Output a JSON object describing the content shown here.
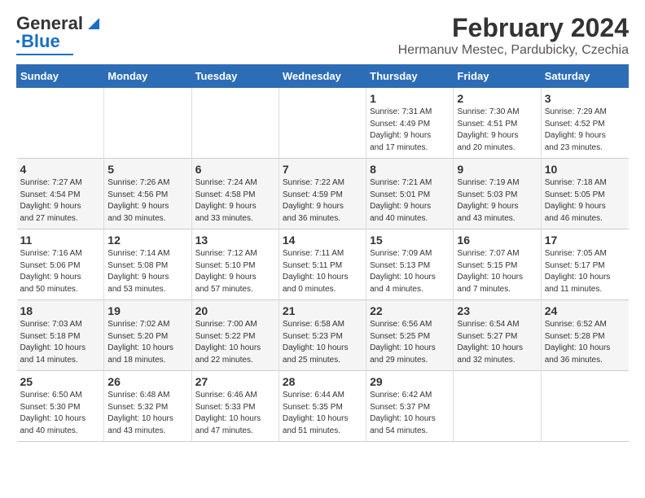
{
  "app": {
    "logo_line1": "General",
    "logo_line2": "Blue"
  },
  "title": "February 2024",
  "subtitle": "Hermanuv Mestec, Pardubicky, Czechia",
  "days_of_week": [
    "Sunday",
    "Monday",
    "Tuesday",
    "Wednesday",
    "Thursday",
    "Friday",
    "Saturday"
  ],
  "weeks": [
    [
      {
        "day": "",
        "info": ""
      },
      {
        "day": "",
        "info": ""
      },
      {
        "day": "",
        "info": ""
      },
      {
        "day": "",
        "info": ""
      },
      {
        "day": "1",
        "info": "Sunrise: 7:31 AM\nSunset: 4:49 PM\nDaylight: 9 hours\nand 17 minutes."
      },
      {
        "day": "2",
        "info": "Sunrise: 7:30 AM\nSunset: 4:51 PM\nDaylight: 9 hours\nand 20 minutes."
      },
      {
        "day": "3",
        "info": "Sunrise: 7:29 AM\nSunset: 4:52 PM\nDaylight: 9 hours\nand 23 minutes."
      }
    ],
    [
      {
        "day": "4",
        "info": "Sunrise: 7:27 AM\nSunset: 4:54 PM\nDaylight: 9 hours\nand 27 minutes."
      },
      {
        "day": "5",
        "info": "Sunrise: 7:26 AM\nSunset: 4:56 PM\nDaylight: 9 hours\nand 30 minutes."
      },
      {
        "day": "6",
        "info": "Sunrise: 7:24 AM\nSunset: 4:58 PM\nDaylight: 9 hours\nand 33 minutes."
      },
      {
        "day": "7",
        "info": "Sunrise: 7:22 AM\nSunset: 4:59 PM\nDaylight: 9 hours\nand 36 minutes."
      },
      {
        "day": "8",
        "info": "Sunrise: 7:21 AM\nSunset: 5:01 PM\nDaylight: 9 hours\nand 40 minutes."
      },
      {
        "day": "9",
        "info": "Sunrise: 7:19 AM\nSunset: 5:03 PM\nDaylight: 9 hours\nand 43 minutes."
      },
      {
        "day": "10",
        "info": "Sunrise: 7:18 AM\nSunset: 5:05 PM\nDaylight: 9 hours\nand 46 minutes."
      }
    ],
    [
      {
        "day": "11",
        "info": "Sunrise: 7:16 AM\nSunset: 5:06 PM\nDaylight: 9 hours\nand 50 minutes."
      },
      {
        "day": "12",
        "info": "Sunrise: 7:14 AM\nSunset: 5:08 PM\nDaylight: 9 hours\nand 53 minutes."
      },
      {
        "day": "13",
        "info": "Sunrise: 7:12 AM\nSunset: 5:10 PM\nDaylight: 9 hours\nand 57 minutes."
      },
      {
        "day": "14",
        "info": "Sunrise: 7:11 AM\nSunset: 5:11 PM\nDaylight: 10 hours\nand 0 minutes."
      },
      {
        "day": "15",
        "info": "Sunrise: 7:09 AM\nSunset: 5:13 PM\nDaylight: 10 hours\nand 4 minutes."
      },
      {
        "day": "16",
        "info": "Sunrise: 7:07 AM\nSunset: 5:15 PM\nDaylight: 10 hours\nand 7 minutes."
      },
      {
        "day": "17",
        "info": "Sunrise: 7:05 AM\nSunset: 5:17 PM\nDaylight: 10 hours\nand 11 minutes."
      }
    ],
    [
      {
        "day": "18",
        "info": "Sunrise: 7:03 AM\nSunset: 5:18 PM\nDaylight: 10 hours\nand 14 minutes."
      },
      {
        "day": "19",
        "info": "Sunrise: 7:02 AM\nSunset: 5:20 PM\nDaylight: 10 hours\nand 18 minutes."
      },
      {
        "day": "20",
        "info": "Sunrise: 7:00 AM\nSunset: 5:22 PM\nDaylight: 10 hours\nand 22 minutes."
      },
      {
        "day": "21",
        "info": "Sunrise: 6:58 AM\nSunset: 5:23 PM\nDaylight: 10 hours\nand 25 minutes."
      },
      {
        "day": "22",
        "info": "Sunrise: 6:56 AM\nSunset: 5:25 PM\nDaylight: 10 hours\nand 29 minutes."
      },
      {
        "day": "23",
        "info": "Sunrise: 6:54 AM\nSunset: 5:27 PM\nDaylight: 10 hours\nand 32 minutes."
      },
      {
        "day": "24",
        "info": "Sunrise: 6:52 AM\nSunset: 5:28 PM\nDaylight: 10 hours\nand 36 minutes."
      }
    ],
    [
      {
        "day": "25",
        "info": "Sunrise: 6:50 AM\nSunset: 5:30 PM\nDaylight: 10 hours\nand 40 minutes."
      },
      {
        "day": "26",
        "info": "Sunrise: 6:48 AM\nSunset: 5:32 PM\nDaylight: 10 hours\nand 43 minutes."
      },
      {
        "day": "27",
        "info": "Sunrise: 6:46 AM\nSunset: 5:33 PM\nDaylight: 10 hours\nand 47 minutes."
      },
      {
        "day": "28",
        "info": "Sunrise: 6:44 AM\nSunset: 5:35 PM\nDaylight: 10 hours\nand 51 minutes."
      },
      {
        "day": "29",
        "info": "Sunrise: 6:42 AM\nSunset: 5:37 PM\nDaylight: 10 hours\nand 54 minutes."
      },
      {
        "day": "",
        "info": ""
      },
      {
        "day": "",
        "info": ""
      }
    ]
  ]
}
